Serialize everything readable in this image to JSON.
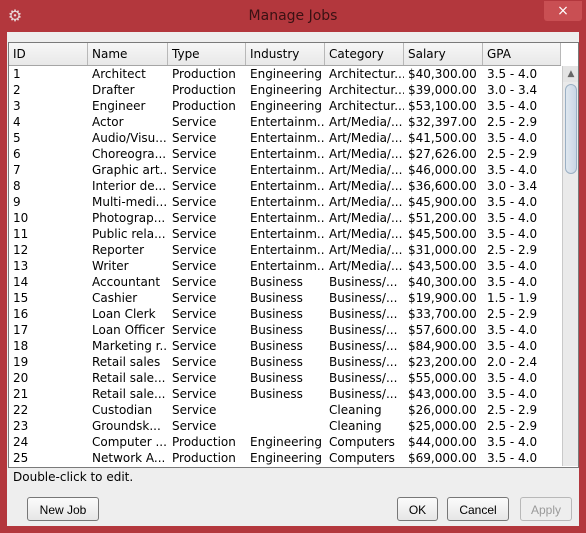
{
  "window": {
    "title": "Manage Jobs",
    "icon": "gear-icon",
    "close_glyph": "×"
  },
  "table": {
    "columns": [
      "ID",
      "Name",
      "Type",
      "Industry",
      "Category",
      "Salary",
      "GPA"
    ],
    "rows": [
      [
        "1",
        "Architect",
        "Production",
        "Engineering",
        "Architectur...",
        "$40,300.00",
        "3.5 - 4.0"
      ],
      [
        "2",
        "Drafter",
        "Production",
        "Engineering",
        "Architectur...",
        "$39,000.00",
        "3.0 - 3.4"
      ],
      [
        "3",
        "Engineer",
        "Production",
        "Engineering",
        "Architectur...",
        "$53,100.00",
        "3.5 - 4.0"
      ],
      [
        "4",
        "Actor",
        "Service",
        "Entertainm...",
        "Art/Media/...",
        "$32,397.00",
        "2.5 - 2.9"
      ],
      [
        "5",
        "Audio/Visu...",
        "Service",
        "Entertainm...",
        "Art/Media/...",
        "$41,500.00",
        "3.5 - 4.0"
      ],
      [
        "6",
        "Choreogra...",
        "Service",
        "Entertainm...",
        "Art/Media/...",
        "$27,626.00",
        "2.5 - 2.9"
      ],
      [
        "7",
        "Graphic art...",
        "Service",
        "Entertainm...",
        "Art/Media/...",
        "$46,000.00",
        "3.5 - 4.0"
      ],
      [
        "8",
        "Interior de...",
        "Service",
        "Entertainm...",
        "Art/Media/...",
        "$36,600.00",
        "3.0 - 3.4"
      ],
      [
        "9",
        "Multi-medi...",
        "Service",
        "Entertainm...",
        "Art/Media/...",
        "$45,900.00",
        "3.5 - 4.0"
      ],
      [
        "10",
        "Photograp...",
        "Service",
        "Entertainm...",
        "Art/Media/...",
        "$51,200.00",
        "3.5 - 4.0"
      ],
      [
        "11",
        "Public rela...",
        "Service",
        "Entertainm...",
        "Art/Media/...",
        "$45,500.00",
        "3.5 - 4.0"
      ],
      [
        "12",
        "Reporter",
        "Service",
        "Entertainm...",
        "Art/Media/...",
        "$31,000.00",
        "2.5 - 2.9"
      ],
      [
        "13",
        "Writer",
        "Service",
        "Entertainm...",
        "Art/Media/...",
        "$43,500.00",
        "3.5 - 4.0"
      ],
      [
        "14",
        "Accountant",
        "Service",
        "Business",
        "Business/...",
        "$40,300.00",
        "3.5 - 4.0"
      ],
      [
        "15",
        "Cashier",
        "Service",
        "Business",
        "Business/...",
        "$19,900.00",
        "1.5 - 1.9"
      ],
      [
        "16",
        "Loan Clerk",
        "Service",
        "Business",
        "Business/...",
        "$33,700.00",
        "2.5 - 2.9"
      ],
      [
        "17",
        "Loan Officer",
        "Service",
        "Business",
        "Business/...",
        "$57,600.00",
        "3.5 - 4.0"
      ],
      [
        "18",
        "Marketing r...",
        "Service",
        "Business",
        "Business/...",
        "$84,900.00",
        "3.5 - 4.0"
      ],
      [
        "19",
        "Retail sales",
        "Service",
        "Business",
        "Business/...",
        "$23,200.00",
        "2.0 - 2.4"
      ],
      [
        "20",
        "Retail sale...",
        "Service",
        "Business",
        "Business/...",
        "$55,000.00",
        "3.5 - 4.0"
      ],
      [
        "21",
        "Retail sale...",
        "Service",
        "Business",
        "Business/...",
        "$43,000.00",
        "3.5 - 4.0"
      ],
      [
        "22",
        "Custodian",
        "Service",
        "",
        "Cleaning",
        "$26,000.00",
        "2.5 - 2.9"
      ],
      [
        "23",
        "Groundsk...",
        "Service",
        "",
        "Cleaning",
        "$25,000.00",
        "2.5 - 2.9"
      ],
      [
        "24",
        "Computer ...",
        "Production",
        "Engineering",
        "Computers",
        "$44,000.00",
        "3.5 - 4.0"
      ],
      [
        "25",
        "Network A...",
        "Production",
        "Engineering",
        "Computers",
        "$69,000.00",
        "3.5 - 4.0"
      ]
    ]
  },
  "hint": "Double-click to edit.",
  "buttons": {
    "new_job": "New Job",
    "ok": "OK",
    "cancel": "Cancel",
    "apply": "Apply"
  }
}
